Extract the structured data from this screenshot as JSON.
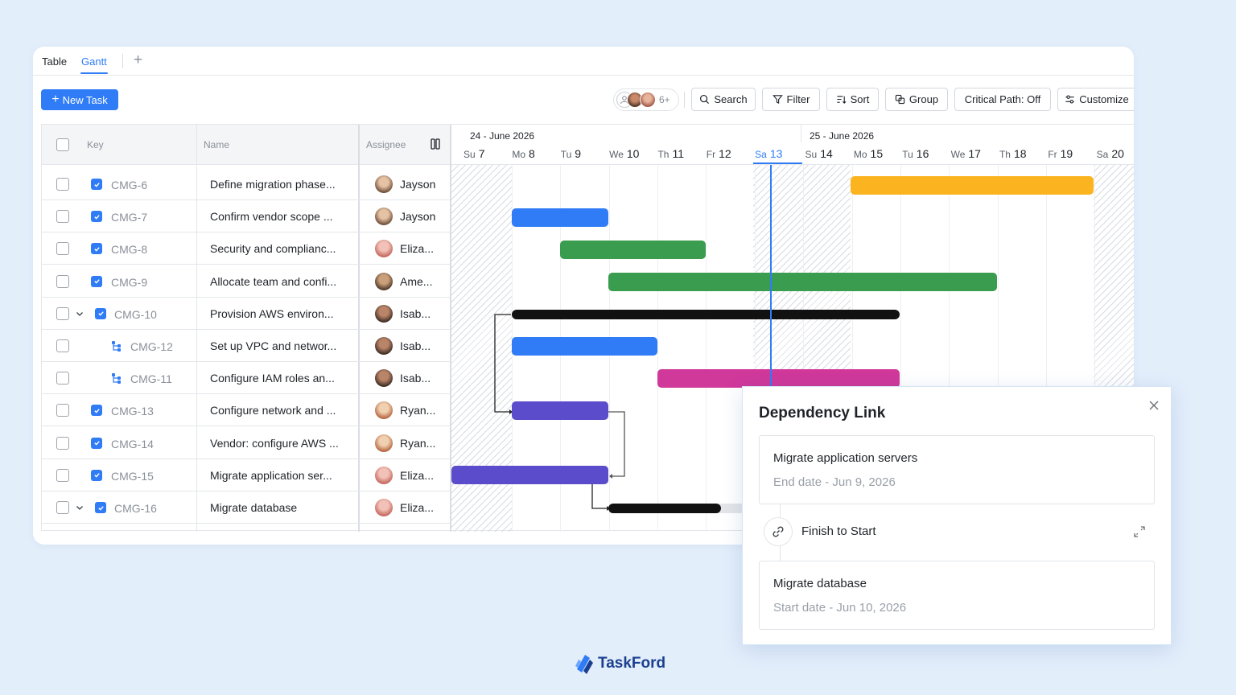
{
  "tabs": {
    "table": "Table",
    "gantt": "Gantt",
    "add": "+"
  },
  "toolbar": {
    "new_task": "New Task",
    "avatars_more": "6+",
    "search": "Search",
    "filter": "Filter",
    "sort": "Sort",
    "group": "Group",
    "critical_path": "Critical Path: Off",
    "customize": "Customize"
  },
  "columns": {
    "key": "Key",
    "name": "Name",
    "assignee": "Assignee"
  },
  "timeline": {
    "weeks": [
      "24 - June 2026",
      "25 - June 2026"
    ],
    "days": [
      {
        "dn": "Su",
        "dd": "7"
      },
      {
        "dn": "Mo",
        "dd": "8"
      },
      {
        "dn": "Tu",
        "dd": "9"
      },
      {
        "dn": "We",
        "dd": "10"
      },
      {
        "dn": "Th",
        "dd": "11"
      },
      {
        "dn": "Fr",
        "dd": "12"
      },
      {
        "dn": "Sa",
        "dd": "13"
      },
      {
        "dn": "Su",
        "dd": "14"
      },
      {
        "dn": "Mo",
        "dd": "15"
      },
      {
        "dn": "Tu",
        "dd": "16"
      },
      {
        "dn": "We",
        "dd": "17"
      },
      {
        "dn": "Th",
        "dd": "18"
      },
      {
        "dn": "Fr",
        "dd": "19"
      },
      {
        "dn": "Sa",
        "dd": "20"
      }
    ],
    "today": "Sa 13"
  },
  "rows": [
    {
      "key": "CMG-6",
      "name": "Define migration phase...",
      "assignee": "Jayson"
    },
    {
      "key": "CMG-7",
      "name": "Confirm vendor scope ...",
      "assignee": "Jayson"
    },
    {
      "key": "CMG-8",
      "name": "Security and complianc...",
      "assignee": "Eliza..."
    },
    {
      "key": "CMG-9",
      "name": "Allocate team and confi...",
      "assignee": "Ame..."
    },
    {
      "key": "CMG-10",
      "name": "Provision AWS environ...",
      "assignee": "Isab..."
    },
    {
      "key": "CMG-12",
      "name": "Set up VPC and networ...",
      "assignee": "Isab..."
    },
    {
      "key": "CMG-11",
      "name": "Configure IAM roles an...",
      "assignee": "Isab..."
    },
    {
      "key": "CMG-13",
      "name": "Configure network and ...",
      "assignee": "Ryan..."
    },
    {
      "key": "CMG-14",
      "name": "Vendor: configure AWS ...",
      "assignee": "Ryan..."
    },
    {
      "key": "CMG-15",
      "name": "Migrate application ser...",
      "assignee": "Eliza..."
    },
    {
      "key": "CMG-16",
      "name": "Migrate database",
      "assignee": "Eliza..."
    }
  ],
  "colors": {
    "accent": "#2f7cf6",
    "yellow": "#fbb420",
    "blue": "#2f7cf6",
    "green": "#3a9c4f",
    "black": "#111111",
    "magenta": "#d0389a",
    "purple": "#5b4ccc",
    "brand": "#1a3f8f"
  },
  "popup": {
    "title": "Dependency Link",
    "from_task": "Migrate application servers",
    "from_date": "End date - Jun 9, 2026",
    "link_type": "Finish to Start",
    "to_task": "Migrate database",
    "to_date": "Start date - Jun 10, 2026"
  },
  "brand": {
    "name": "TaskFord"
  }
}
